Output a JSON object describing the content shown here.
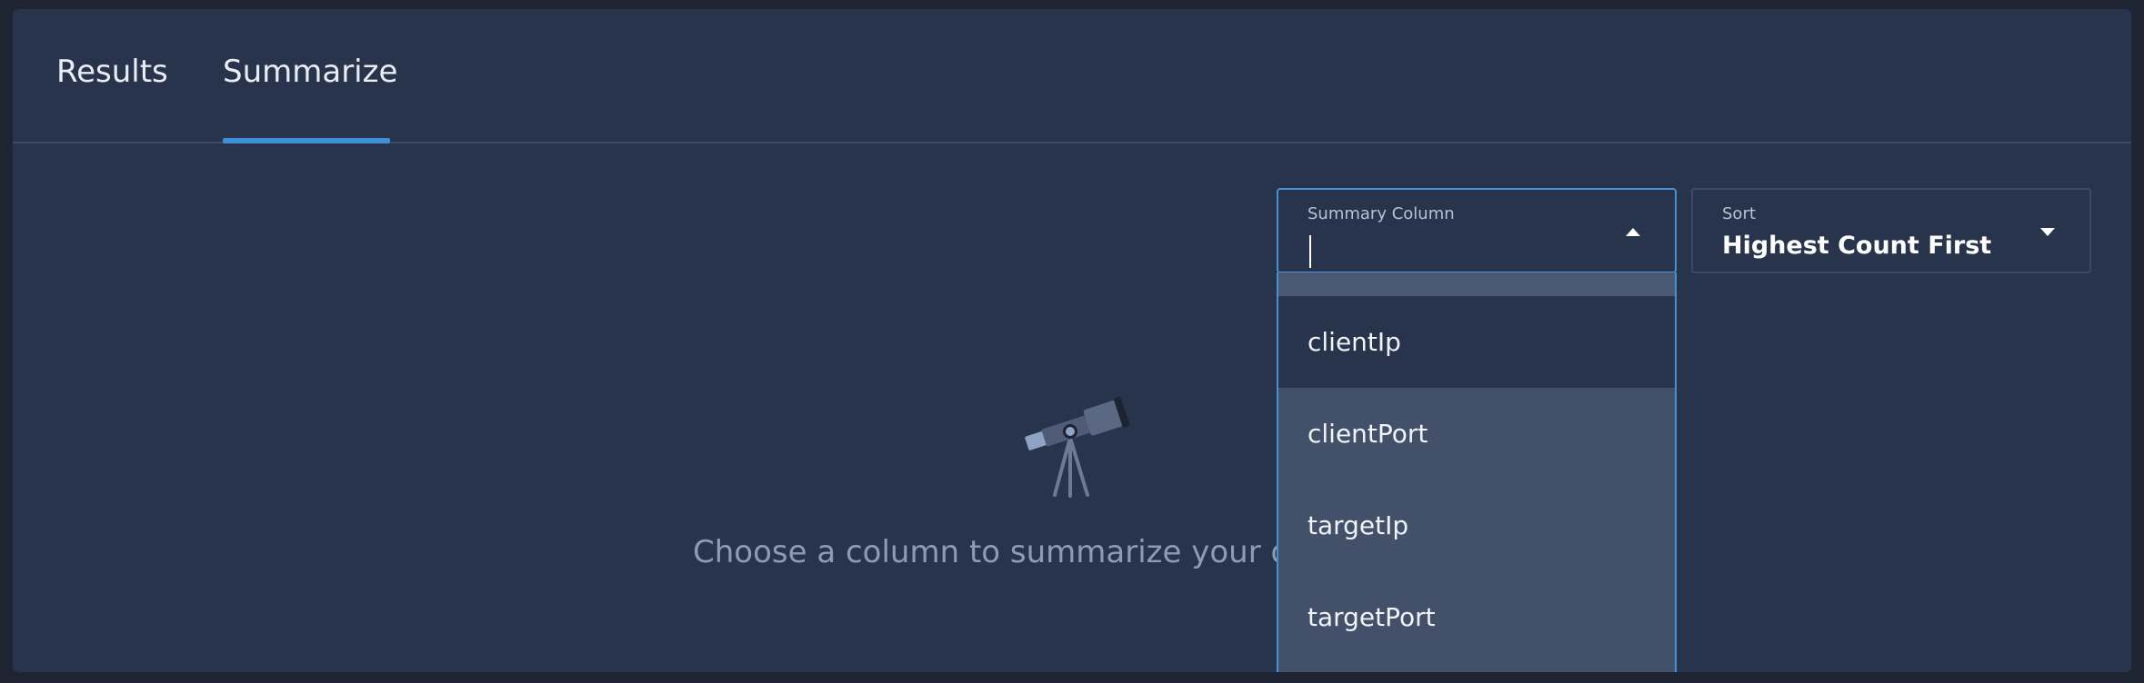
{
  "tabs": {
    "results_label": "Results",
    "summarize_label": "Summarize",
    "active": "Summarize"
  },
  "summary_column": {
    "label": "Summary Column",
    "value": ""
  },
  "sort": {
    "label": "Sort",
    "value": "Highest Count First"
  },
  "dropdown": {
    "options": [
      "clientIp",
      "clientPort",
      "targetIp",
      "targetPort"
    ],
    "highlighted_index": 0
  },
  "empty_state": {
    "icon": "telescope-icon",
    "message": "Choose a column to summarize your q"
  },
  "colors": {
    "background": "#28344c",
    "accent": "#4a90d9",
    "dropdown_bg": "#435069"
  }
}
